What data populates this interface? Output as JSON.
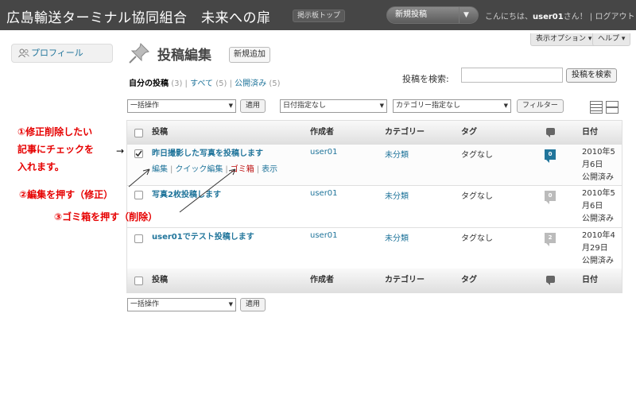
{
  "header": {
    "site_title": "広島輸送ターミナル協同組合　未来への扉",
    "visit_site": "掲示板トップ",
    "favorite": "新規投稿",
    "favorite_arrow": "▼",
    "greeting_prefix": "こんにちは、",
    "username": "user01",
    "greeting_suffix": "さん！",
    "separator": "|",
    "logout": "ログアウト"
  },
  "screen_meta": {
    "options": "表示オプション ▾",
    "help": "ヘルプ ▾"
  },
  "sidebar": {
    "profile": "プロフィール"
  },
  "page": {
    "title": "投稿編集",
    "add_new": "新規追加"
  },
  "filters": {
    "mine": "自分の投稿",
    "mine_count": "(3)",
    "sep": "|",
    "all": "すべて",
    "all_count": "(5)",
    "published": "公開済み",
    "published_count": "(5)"
  },
  "search": {
    "label": "投稿を検索:",
    "value": "",
    "button": "投稿を検索"
  },
  "bulk": {
    "select": "一括操作",
    "apply": "適用"
  },
  "date_filter": "日付指定なし",
  "category_filter": "カテゴリー指定なし",
  "filter_button": "フィルター",
  "columns": {
    "title": "投稿",
    "author": "作成者",
    "categories": "カテゴリー",
    "tags": "タグ",
    "date": "日付"
  },
  "posts": [
    {
      "title": "昨日撮影した写真を投稿します",
      "author": "user01",
      "category": "未分類",
      "tags": "タグなし",
      "comments": "0",
      "date_line1": "2010年5",
      "date_line2": "月6日",
      "status": "公開済み",
      "checked": true,
      "actions": {
        "edit": "編集",
        "quick_edit": "クイック編集",
        "trash": "ゴミ箱",
        "view": "表示",
        "sep": "|"
      }
    },
    {
      "title": "写真2枚投稿します",
      "author": "user01",
      "category": "未分類",
      "tags": "タグなし",
      "comments": "0",
      "date_line1": "2010年5",
      "date_line2": "月6日",
      "status": "公開済み",
      "checked": false
    },
    {
      "title": "user01でテスト投稿します",
      "author": "user01",
      "category": "未分類",
      "tags": "タグなし",
      "comments": "2",
      "date_line1": "2010年4",
      "date_line2": "月29日",
      "status": "公開済み",
      "checked": false
    }
  ],
  "annotations": {
    "step1_line1": "①修正削除したい",
    "step1_line2": "記事にチェックを",
    "step1_line3": "入れます。",
    "step1_arrow": "→",
    "step2": "②編集を押す（修正）",
    "step3": "③ゴミ箱を押す（削除）",
    "color": "#e60000"
  },
  "colors": {
    "header_bg": "#464646",
    "link": "#21759b",
    "trash": "#bc0b0b",
    "comment_bubble": "#21759b"
  }
}
